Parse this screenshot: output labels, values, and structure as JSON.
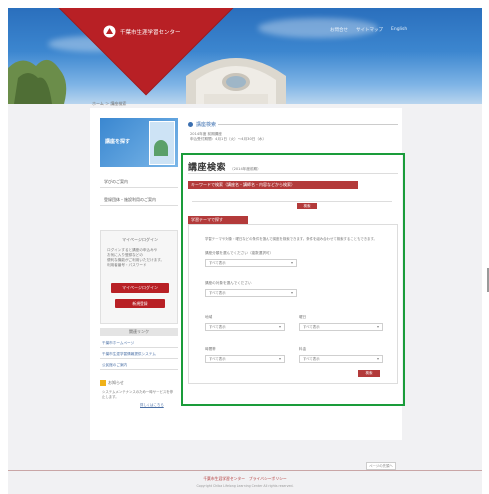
{
  "header": {
    "logo_text": "千葉市生涯学習センター",
    "links": [
      "お問合せ",
      "サイトマップ",
      "English"
    ]
  },
  "breadcrumb": "ホーム ＞ 講座検索",
  "sidebar": {
    "banner_title": "講座を探す",
    "links": [
      "学びのご案内",
      "登録団体・施設利用のご案内"
    ],
    "member": {
      "title": "マイページログイン",
      "lines": [
        "ログインすると講座の申込みや",
        "お気に入り登録などの",
        "便利な機能がご利用いただけます。",
        "利用者番号・パスワード"
      ],
      "login": "マイページログイン",
      "register": "新規登録"
    },
    "menu": {
      "title": "関連リンク",
      "links": [
        "千葉市ホームページ",
        "千葉市生涯学習情報提供システム",
        "公民館のご案内"
      ]
    },
    "notice": {
      "title": "お知らせ",
      "text": "システムメンテナンスのため一時サービスを停止します。",
      "link": "詳しくはこちら"
    }
  },
  "section": {
    "heading": "講座検索",
    "meta": [
      "2014年度 前期講座",
      "申込受付期間：4月1日（火）〜4月30日（水）"
    ]
  },
  "search": {
    "title": "講座検索",
    "subtitle": "（2014年度前期）",
    "keyword_label": "キーワードで検索（講座名・講師名・内容などから検索）",
    "search_button": "検索",
    "theme_label": "学習テーマで探す",
    "description": "学習テーマや対象・曜日などの条件を選んで講座を検索できます。条件を組み合わせて検索することもできます。",
    "q1": "講座分類を選んでください（複数選択可）",
    "q1_default": "すべて表示",
    "q2": "講座の対象を選んでください",
    "q2_default": "すべて表示",
    "fields": [
      {
        "label": "地域",
        "value": "すべて表示"
      },
      {
        "label": "曜日",
        "value": "すべて表示"
      },
      {
        "label": "時間帯",
        "value": "すべて表示"
      },
      {
        "label": "料金",
        "value": "すべて表示"
      }
    ],
    "search_button2": "検索"
  },
  "footer": {
    "pagetop": "ページの先頭へ",
    "links": "千葉市生涯学習センター　プライバシーポリシー",
    "copyright": "Copyright Chiba Lifelong Learning Center All rights reserved."
  },
  "colors": {
    "accent": "#b82025",
    "highlight": "#1a9c3a",
    "link": "#4a6fa5"
  }
}
